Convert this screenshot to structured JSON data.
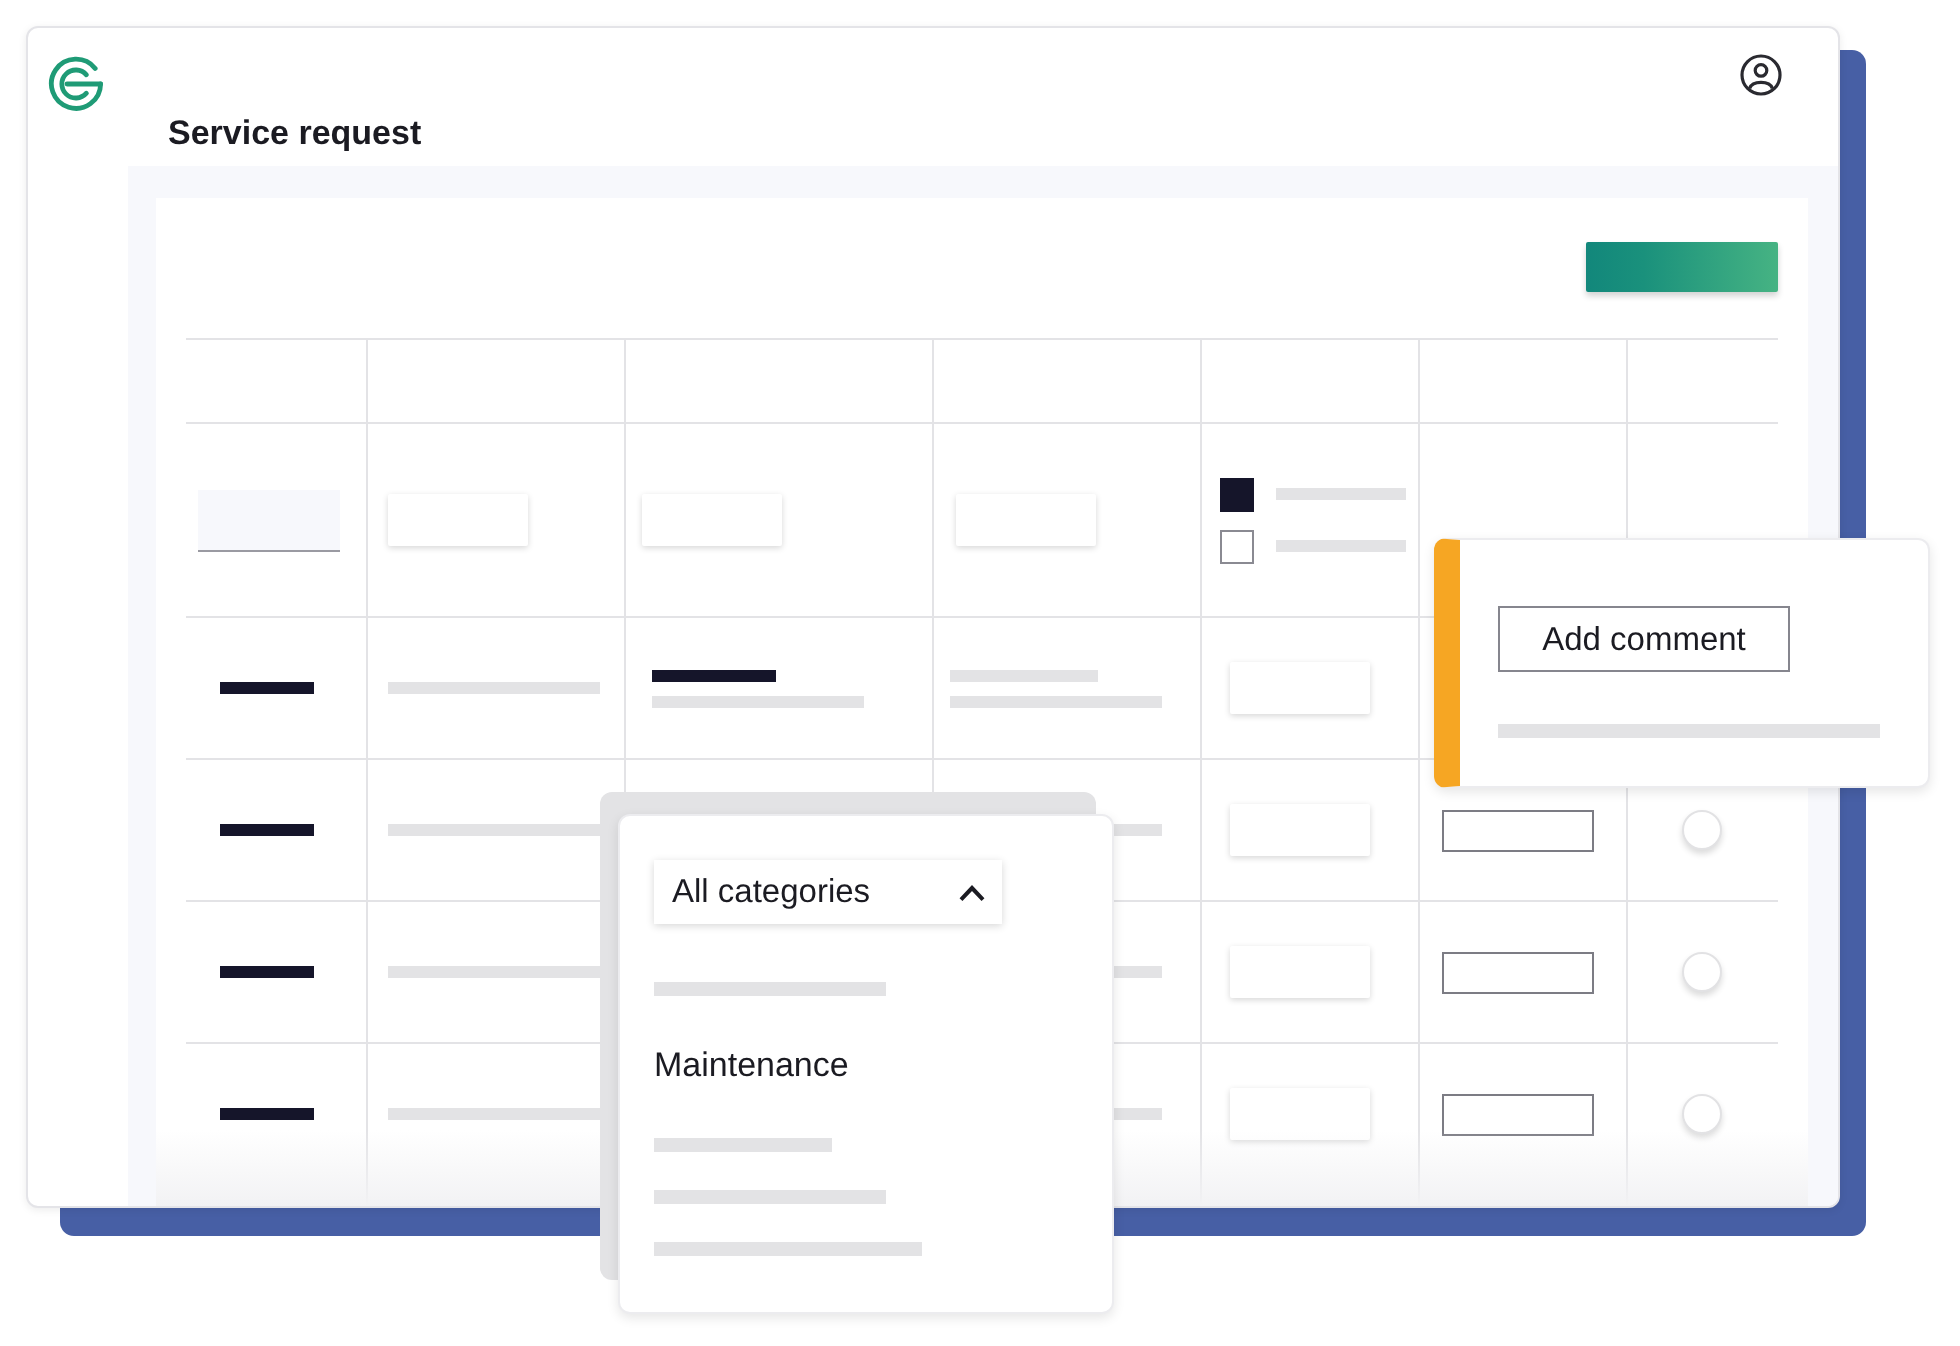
{
  "header": {
    "title": "Service request"
  },
  "table": {
    "rows": [
      {
        "cells": [
          {
            "kind": "field"
          },
          {
            "kind": "tile"
          },
          {
            "kind": "tile"
          },
          {
            "kind": "tile"
          },
          {
            "kind": "checks",
            "items": [
              {
                "checked": true
              },
              {
                "checked": false
              }
            ]
          },
          {
            "kind": "blank"
          },
          {
            "kind": "blank"
          }
        ]
      },
      {
        "cells": [
          {
            "kind": "lines",
            "lines": [
              {
                "kind": "dark"
              }
            ]
          },
          {
            "kind": "lines",
            "lines": [
              {
                "kind": "light"
              }
            ]
          },
          {
            "kind": "lines",
            "lines": [
              {
                "kind": "dark"
              },
              {
                "kind": "light"
              }
            ]
          },
          {
            "kind": "lines",
            "lines": [
              {
                "kind": "light"
              },
              {
                "kind": "light"
              }
            ]
          },
          {
            "kind": "tile"
          },
          {
            "kind": "blank"
          },
          {
            "kind": "blank"
          }
        ]
      },
      {
        "cells": [
          {
            "kind": "lines",
            "lines": [
              {
                "kind": "dark"
              }
            ]
          },
          {
            "kind": "lines",
            "lines": [
              {
                "kind": "light"
              }
            ]
          },
          {
            "kind": "blank"
          },
          {
            "kind": "lines",
            "lines": [
              {
                "kind": "light"
              }
            ]
          },
          {
            "kind": "tile"
          },
          {
            "kind": "outlined-field"
          },
          {
            "kind": "radio",
            "selected": false
          }
        ]
      },
      {
        "cells": [
          {
            "kind": "lines",
            "lines": [
              {
                "kind": "dark"
              }
            ]
          },
          {
            "kind": "lines",
            "lines": [
              {
                "kind": "light"
              }
            ]
          },
          {
            "kind": "blank"
          },
          {
            "kind": "lines",
            "lines": [
              {
                "kind": "light"
              }
            ]
          },
          {
            "kind": "tile"
          },
          {
            "kind": "outlined-field"
          },
          {
            "kind": "radio",
            "selected": false
          }
        ]
      },
      {
        "cells": [
          {
            "kind": "lines",
            "lines": [
              {
                "kind": "dark"
              }
            ]
          },
          {
            "kind": "lines",
            "lines": [
              {
                "kind": "light"
              }
            ]
          },
          {
            "kind": "blank"
          },
          {
            "kind": "lines",
            "lines": [
              {
                "kind": "light"
              }
            ]
          },
          {
            "kind": "tile"
          },
          {
            "kind": "outlined-field"
          },
          {
            "kind": "radio",
            "selected": false
          }
        ]
      }
    ]
  },
  "comment_popup": {
    "button": "Add comment"
  },
  "category_dropdown": {
    "value": "All categories",
    "expanded": true,
    "options": [
      {
        "kind": "placeholder"
      },
      {
        "kind": "text",
        "label": "Maintenance"
      },
      {
        "kind": "placeholder"
      },
      {
        "kind": "placeholder"
      },
      {
        "kind": "placeholder"
      }
    ]
  }
}
